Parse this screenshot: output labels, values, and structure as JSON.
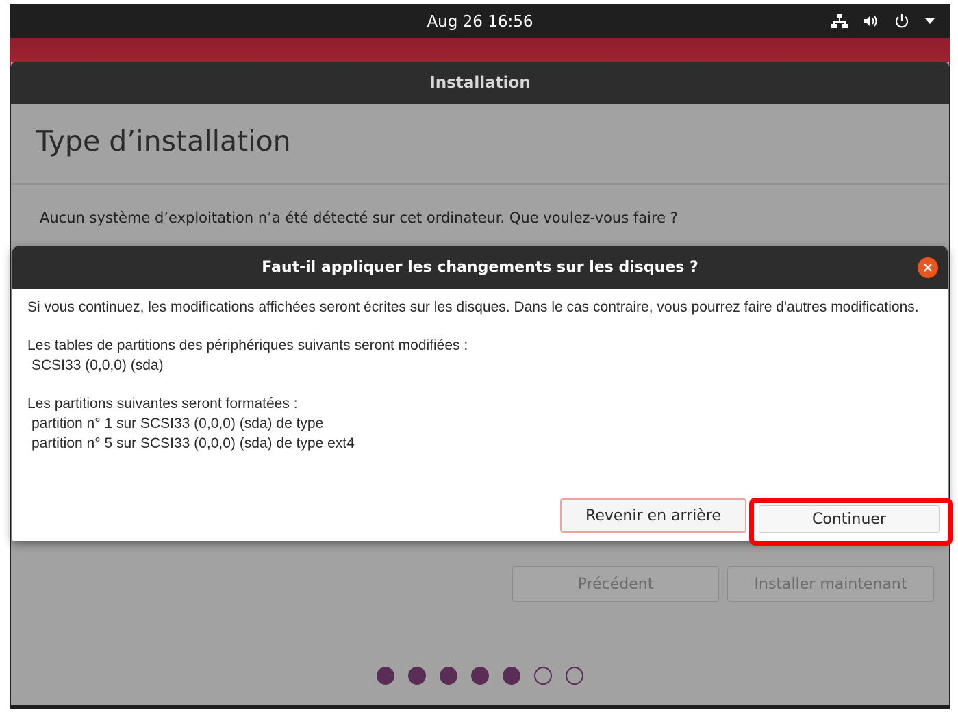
{
  "topbar": {
    "clock": "Aug 26  16:56",
    "icons": [
      "network-icon",
      "volume-icon",
      "power-icon",
      "chevron-down-icon"
    ]
  },
  "installer": {
    "window_title": "Installation",
    "page_title": "Type d’installation",
    "question": "Aucun système d’exploitation n’a été détecté sur cet ordinateur. Que voulez-vous faire ?",
    "buttons": {
      "previous": "Précédent",
      "install_now": "Installer maintenant"
    },
    "progress": {
      "total_steps": 7,
      "completed_steps": 5
    }
  },
  "dialog": {
    "title": "Faut-il appliquer les changements sur les disques ?",
    "intro": "Si vous continuez, les modifications affichées seront écrites sur les disques. Dans le cas contraire, vous pourrez faire d'autres modifications.",
    "tables_heading": "Les tables de partitions des périphériques suivants seront modifiées :",
    "tables_device": "SCSI33 (0,0,0) (sda)",
    "format_heading": "Les partitions suivantes seront formatées :",
    "format_items": [
      "partition n° 1 sur SCSI33 (0,0,0) (sda) de type",
      "partition n° 5 sur SCSI33 (0,0,0) (sda) de type ext4"
    ],
    "buttons": {
      "back": "Revenir en arrière",
      "continue": "Continuer"
    }
  },
  "colors": {
    "accent_orange": "#e9541f",
    "progress_purple": "#5a2d56",
    "highlight_red": "#ff0000"
  }
}
